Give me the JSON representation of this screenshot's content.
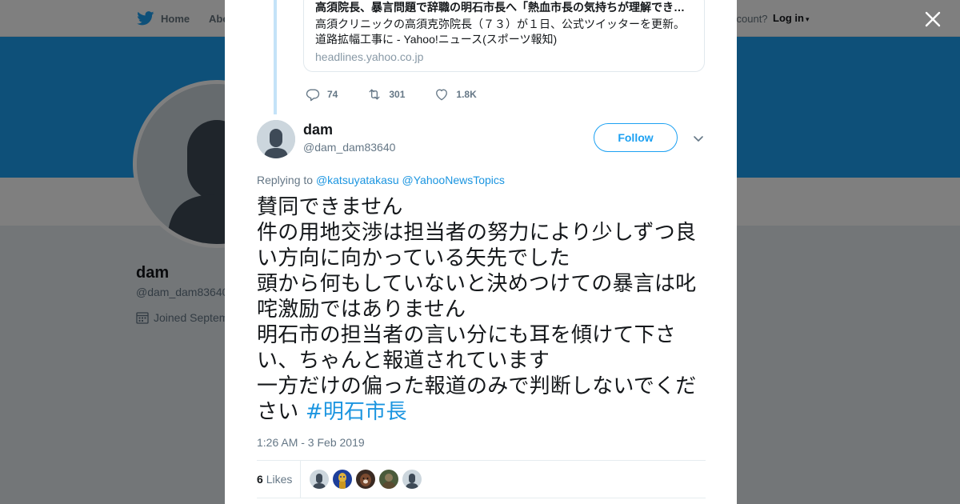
{
  "background": {
    "nav": {
      "home_label": "Home",
      "about_label": "Abo",
      "account_text": "ccount?",
      "login_label": "Log in"
    },
    "profile": {
      "name": "dam",
      "handle": "@dam_dam83640",
      "joined_text": "Joined Septem"
    }
  },
  "thread": {
    "card": {
      "title": "高須院長、暴言問題で辞職の明石市長へ「熱血市長の気持ちが理解でき…",
      "description": "高須クリニックの高須克弥院長（７３）が１日、公式ツイッターを更新。道路拡幅工事に - Yahoo!ニュース(スポーツ報知)",
      "domain": "headlines.yahoo.co.jp"
    },
    "actions": {
      "replies": "74",
      "retweets": "301",
      "likes": "1.8K"
    }
  },
  "tweet": {
    "author": {
      "name": "dam",
      "handle": "@dam_dam83640"
    },
    "follow_label": "Follow",
    "replying_prefix": "Replying to",
    "replying_to": [
      "@katsuyatakasu",
      "@YahooNewsTopics"
    ],
    "text": "賛同できません\n件の用地交渉は担当者の努力により少しずつ良い方向に向かっている矢先でした\n頭から何もしていないと決めつけての暴言は叱咤激励ではありません\n明石市の担当者の言い分にも耳を傾けて下さい、ちゃんと報道されています\n一方だけの偏った報道のみで判断しないでください ",
    "hashtag": "#明石市長",
    "timestamp": "1:26 AM - 3 Feb 2019",
    "like_count": "6",
    "like_label": "Likes"
  },
  "colors": {
    "brand_blue": "#1da1f2",
    "link_blue": "#1b95e0",
    "muted_text": "#657786"
  },
  "icons": [
    "twitter-bird-icon",
    "close-icon",
    "reply-icon",
    "retweet-icon",
    "heart-icon",
    "chevron-down-icon",
    "calendar-icon"
  ]
}
